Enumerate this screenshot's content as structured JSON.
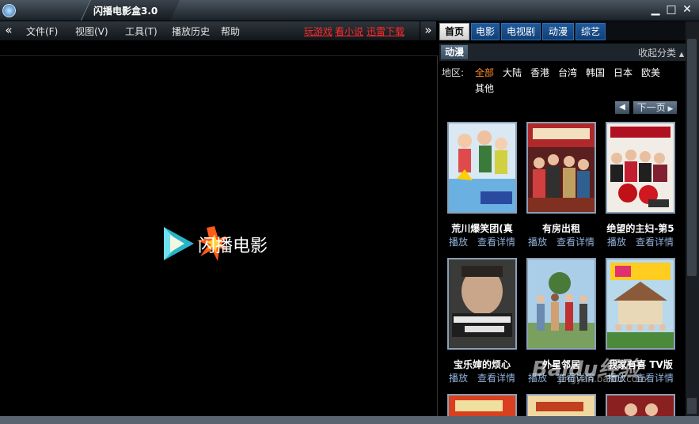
{
  "window": {
    "title": "闪播电影盒3.0",
    "minimize": "▁",
    "maximize": "□",
    "close": "✕"
  },
  "menubar": {
    "collapse": "«",
    "items": [
      "文件(F)",
      "视图(V)",
      "工具(T)",
      "播放历史",
      "帮助"
    ],
    "promos": [
      "玩游戏",
      "看小说",
      "迅雷下载"
    ]
  },
  "player": {
    "logo_text": "闪播电影"
  },
  "panel": {
    "expand": "»",
    "tabs": [
      "首页",
      "电影",
      "电视剧",
      "动漫",
      "综艺"
    ],
    "active_tab": "首页",
    "category_title": "动漫",
    "collapse_category": "收起分类",
    "region_label": "地区:",
    "regions": [
      "全部",
      "大陆",
      "香港",
      "台湾",
      "韩国",
      "日本",
      "欧美",
      "其他"
    ],
    "selected_region": "全部",
    "pager_prev": "◀",
    "pager_next": "下一页",
    "movies": [
      {
        "title": "荒川爆笑团(真",
        "play": "播放",
        "details": "查看详情"
      },
      {
        "title": "有房出租",
        "play": "播放",
        "details": "查看详情"
      },
      {
        "title": "绝望的主妇-第5",
        "play": "播放",
        "details": "查看详情"
      },
      {
        "title": "宝乐婶的烦心",
        "play": "播放",
        "details": "查看详情"
      },
      {
        "title": "外星邻居",
        "play": "播放",
        "details": "查看详情"
      },
      {
        "title": "我家有喜 TV版",
        "play": "播放",
        "details": "查看详情"
      }
    ]
  },
  "watermark": {
    "brand": "Baidu经验",
    "url": "jingyan.baidu.com"
  },
  "colors": {
    "promo": "#ff2a2a",
    "selected_region": "#ff8a2a",
    "link": "#8fb0d8",
    "tab_blue": "#1f5a9c"
  }
}
